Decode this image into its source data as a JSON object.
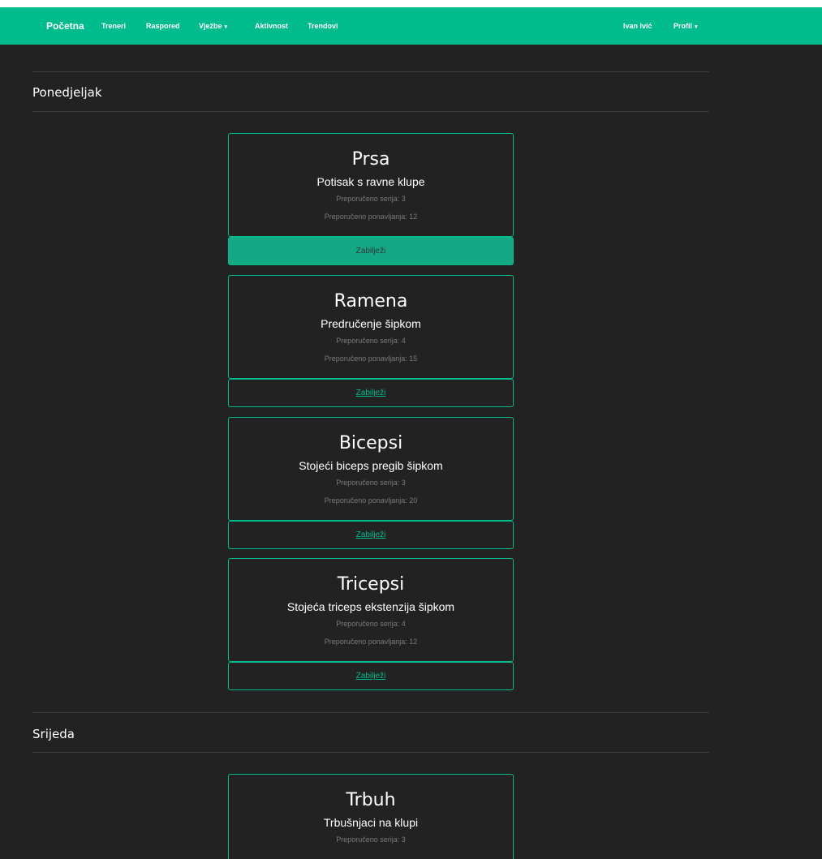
{
  "nav": {
    "brand": "Početna",
    "items": [
      "Treneri",
      "Raspored",
      "Vježbe",
      "Aktivnost",
      "Trendovi"
    ],
    "caret": "▾",
    "user": "Ivan Ivić",
    "profile": "Profil"
  },
  "days": [
    {
      "name": "Ponedjeljak",
      "cards": [
        {
          "muscle": "Prsa",
          "exercise": "Potisak s ravne klupe",
          "sets": "Preporučeno serija: 3",
          "reps": "Preporučeno ponavljanja: 12",
          "button": "Zabilježi"
        },
        {
          "muscle": "Ramena",
          "exercise": "Predručenje šipkom",
          "sets": "Preporučeno serija: 4",
          "reps": "Preporučeno ponavljanja: 15",
          "button": "Zabilježi"
        },
        {
          "muscle": "Bicepsi",
          "exercise": "Stojeći biceps pregib šipkom",
          "sets": "Preporučeno serija: 3",
          "reps": "Preporučeno ponavljanja: 20",
          "button": "Zabilježi"
        },
        {
          "muscle": "Tricepsi",
          "exercise": "Stojeća triceps ekstenzija šipkom",
          "sets": "Preporučeno serija: 4",
          "reps": "Preporučeno ponavljanja: 12",
          "button": "Zabilježi"
        }
      ]
    },
    {
      "name": "Srijeda",
      "cards": [
        {
          "muscle": "Trbuh",
          "exercise": "Trbušnjaci na klupi",
          "sets": "Preporučeno serija: 3"
        }
      ]
    }
  ],
  "colors": {
    "accent": "#00bc8c",
    "background": "#222222",
    "active_button": "#13a985",
    "muted_text": "#7a7a7a"
  }
}
